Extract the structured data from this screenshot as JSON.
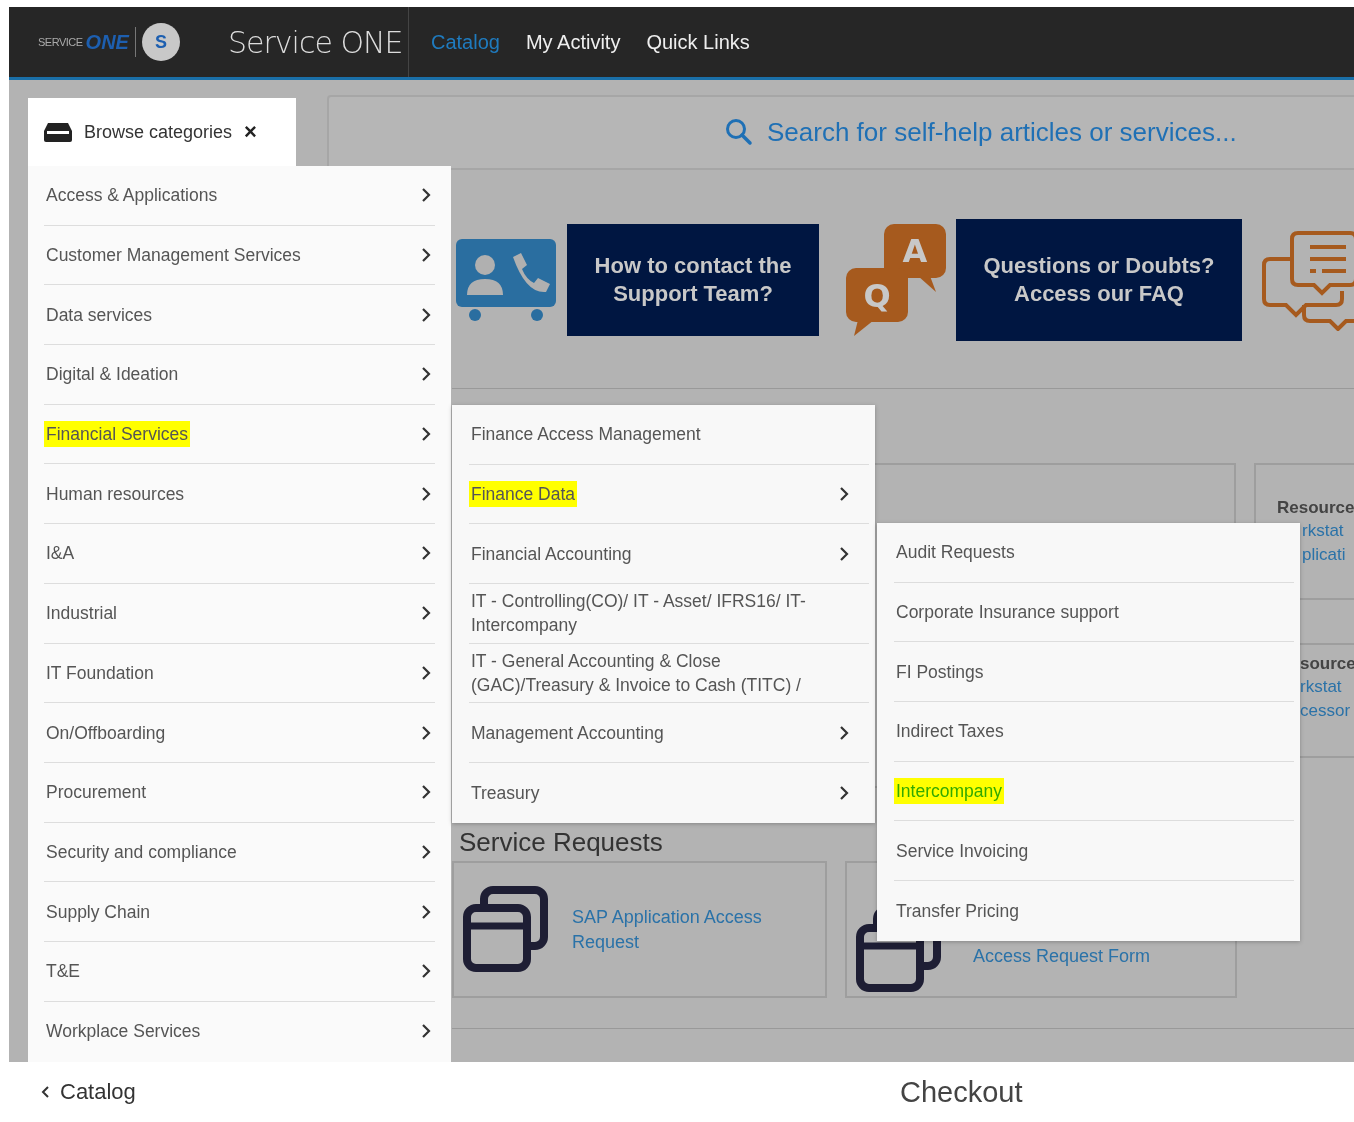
{
  "header": {
    "logo": {
      "small": "SERVICE",
      "big": "ONE",
      "badge": "S"
    },
    "title": "Service ONE",
    "nav": [
      {
        "label": "Catalog",
        "selected": true
      },
      {
        "label": "My Activity",
        "selected": false
      },
      {
        "label": "Quick Links",
        "selected": false
      }
    ]
  },
  "browse_tab": {
    "label": "Browse categories",
    "close": "×"
  },
  "categories": [
    {
      "label": "Access & Applications",
      "highlighted": false,
      "has_submenu": true
    },
    {
      "label": "Customer Management Services",
      "highlighted": false,
      "has_submenu": true
    },
    {
      "label": "Data services",
      "highlighted": false,
      "has_submenu": true
    },
    {
      "label": "Digital & Ideation",
      "highlighted": false,
      "has_submenu": true
    },
    {
      "label": "Financial Services",
      "highlighted": true,
      "has_submenu": true
    },
    {
      "label": "Human resources",
      "highlighted": false,
      "has_submenu": true
    },
    {
      "label": "I&A",
      "highlighted": false,
      "has_submenu": true
    },
    {
      "label": "Industrial",
      "highlighted": false,
      "has_submenu": true
    },
    {
      "label": "IT Foundation",
      "highlighted": false,
      "has_submenu": true
    },
    {
      "label": "On/Offboarding",
      "highlighted": false,
      "has_submenu": true
    },
    {
      "label": "Procurement",
      "highlighted": false,
      "has_submenu": true
    },
    {
      "label": "Security and compliance",
      "highlighted": false,
      "has_submenu": true
    },
    {
      "label": "Supply Chain",
      "highlighted": false,
      "has_submenu": true
    },
    {
      "label": "T&E",
      "highlighted": false,
      "has_submenu": true
    },
    {
      "label": "Workplace Services",
      "highlighted": false,
      "has_submenu": true
    }
  ],
  "submenu": [
    {
      "label": "Finance Access Management",
      "highlighted": false,
      "has_submenu": false
    },
    {
      "label": "Finance Data",
      "highlighted": true,
      "has_submenu": true
    },
    {
      "label": "Financial Accounting",
      "highlighted": false,
      "has_submenu": true
    },
    {
      "label": "IT - Controlling(CO)/ IT - Asset/ IFRS16/ IT-Intercompany",
      "highlighted": false,
      "has_submenu": false
    },
    {
      "label": "IT - General Accounting & Close (GAC)/Treasury & Invoice to Cash (TITC) /",
      "highlighted": false,
      "has_submenu": false
    },
    {
      "label": "Management Accounting",
      "highlighted": false,
      "has_submenu": true
    },
    {
      "label": "Treasury",
      "highlighted": false,
      "has_submenu": true
    }
  ],
  "subsubmenu": [
    {
      "label": "Audit Requests",
      "highlighted": false
    },
    {
      "label": "Corporate Insurance support",
      "highlighted": false
    },
    {
      "label": "FI Postings",
      "highlighted": false
    },
    {
      "label": "Indirect Taxes",
      "highlighted": false
    },
    {
      "label": "Intercompany",
      "highlighted": true
    },
    {
      "label": "Service Invoicing",
      "highlighted": false
    },
    {
      "label": "Transfer Pricing",
      "highlighted": false
    }
  ],
  "search": {
    "placeholder": "Search for self-help articles or services..."
  },
  "banners": [
    {
      "kind": "contact",
      "text": "How to contact the Support Team?"
    },
    {
      "kind": "faq",
      "text": "Questions or Doubts? Access our FAQ",
      "icon_letters": [
        "Q",
        "A"
      ]
    }
  ],
  "resource_cards": [
    {
      "heading": "Resource",
      "lines": [
        "rkstat",
        "plicati"
      ]
    },
    {
      "heading": "source",
      "lines": [
        "rkstat",
        "cessor"
      ]
    }
  ],
  "service_requests": {
    "heading": "Service Requests",
    "items": [
      "SAP Application Access Request",
      "Access Request Form"
    ]
  },
  "footer": {
    "back": "Catalog",
    "title": "Checkout"
  }
}
